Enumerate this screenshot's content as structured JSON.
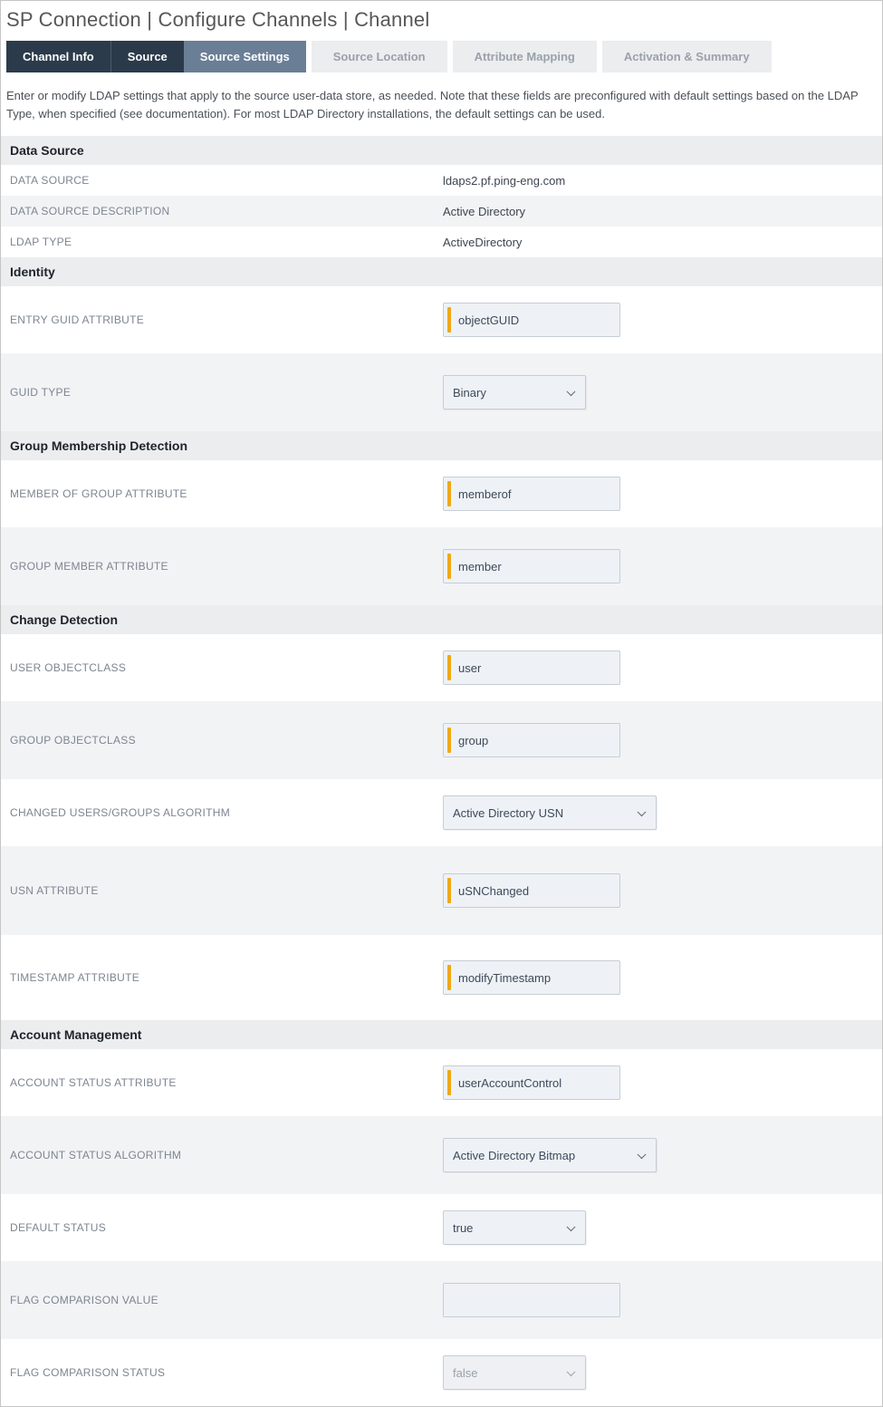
{
  "header": "SP Connection | Configure Channels | Channel",
  "tabs": {
    "channel_info": "Channel Info",
    "source": "Source",
    "source_settings": "Source Settings",
    "source_location": "Source Location",
    "attribute_mapping": "Attribute Mapping",
    "activation_summary": "Activation & Summary"
  },
  "intro": "Enter or modify LDAP settings that apply to the source user-data store, as needed. Note that these fields are preconfigured with default settings based on the LDAP Type, when specified (see documentation). For most LDAP Directory installations, the default settings can be used.",
  "sections": {
    "data_source": {
      "title": "Data Source",
      "data_source_label": "DATA SOURCE",
      "data_source_value": "ldaps2.pf.ping-eng.com",
      "data_source_desc_label": "DATA SOURCE DESCRIPTION",
      "data_source_desc_value": "Active Directory",
      "ldap_type_label": "LDAP TYPE",
      "ldap_type_value": "ActiveDirectory"
    },
    "identity": {
      "title": "Identity",
      "entry_guid_label": "ENTRY GUID ATTRIBUTE",
      "entry_guid_value": "objectGUID",
      "guid_type_label": "GUID TYPE",
      "guid_type_value": "Binary"
    },
    "group_membership": {
      "title": "Group Membership Detection",
      "member_of_label": "MEMBER OF GROUP ATTRIBUTE",
      "member_of_value": "memberof",
      "group_member_label": "GROUP MEMBER ATTRIBUTE",
      "group_member_value": "member"
    },
    "change_detection": {
      "title": "Change Detection",
      "user_objectclass_label": "USER OBJECTCLASS",
      "user_objectclass_value": "user",
      "group_objectclass_label": "GROUP OBJECTCLASS",
      "group_objectclass_value": "group",
      "changed_algo_label": "CHANGED USERS/GROUPS ALGORITHM",
      "changed_algo_value": "Active Directory USN",
      "usn_attr_label": "USN ATTRIBUTE",
      "usn_attr_value": "uSNChanged",
      "timestamp_attr_label": "TIMESTAMP ATTRIBUTE",
      "timestamp_attr_value": "modifyTimestamp"
    },
    "account_management": {
      "title": "Account Management",
      "account_status_attr_label": "ACCOUNT STATUS ATTRIBUTE",
      "account_status_attr_value": "userAccountControl",
      "account_status_algo_label": "ACCOUNT STATUS ALGORITHM",
      "account_status_algo_value": "Active Directory Bitmap",
      "default_status_label": "DEFAULT STATUS",
      "default_status_value": "true",
      "flag_comp_value_label": "FLAG COMPARISON VALUE",
      "flag_comp_value_value": "",
      "flag_comp_status_label": "FLAG COMPARISON STATUS",
      "flag_comp_status_value": "false"
    }
  }
}
